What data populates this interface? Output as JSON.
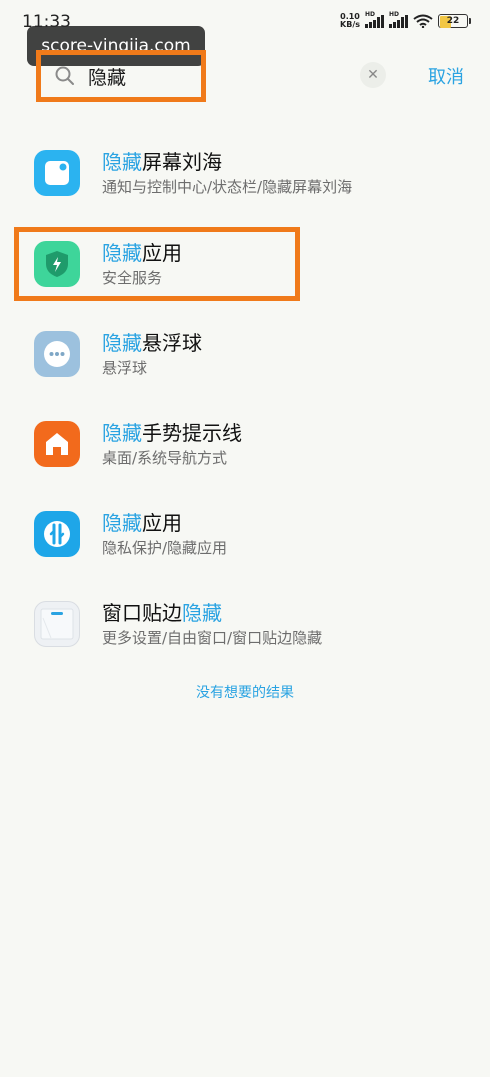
{
  "status_bar": {
    "time": "11:33",
    "net_speed_value": "0.10",
    "net_speed_unit": "KB/s",
    "signal_label": "HD",
    "battery": "22"
  },
  "watermark": "score-yingjia.com",
  "search": {
    "query": "隐藏",
    "cancel_label": "取消"
  },
  "results": [
    {
      "keyword": "隐藏",
      "title_rest": "屏幕刘海",
      "subtitle": "通知与控制中心/状态栏/隐藏屏幕刘海",
      "icon": "notch-icon"
    },
    {
      "keyword": "隐藏",
      "title_rest": "应用",
      "subtitle": "安全服务",
      "icon": "security-shield-icon"
    },
    {
      "keyword": "隐藏",
      "title_rest": "悬浮球",
      "subtitle": "悬浮球",
      "icon": "floating-ball-icon"
    },
    {
      "keyword": "隐藏",
      "title_rest": "手势提示线",
      "subtitle": "桌面/系统导航方式",
      "icon": "home-icon"
    },
    {
      "keyword": "隐藏",
      "title_rest": "应用",
      "subtitle": "隐私保护/隐藏应用",
      "icon": "privacy-icon"
    },
    {
      "title_prefix": "窗口贴边",
      "keyword": "隐藏",
      "subtitle": "更多设置/自由窗口/窗口贴边隐藏",
      "icon": "window-edge-icon"
    }
  ],
  "no_result_label": "没有想要的结果",
  "colors": {
    "accent": "#2aa3e2",
    "highlight_box": "#f07a1a",
    "background": "#f7f8f4"
  }
}
